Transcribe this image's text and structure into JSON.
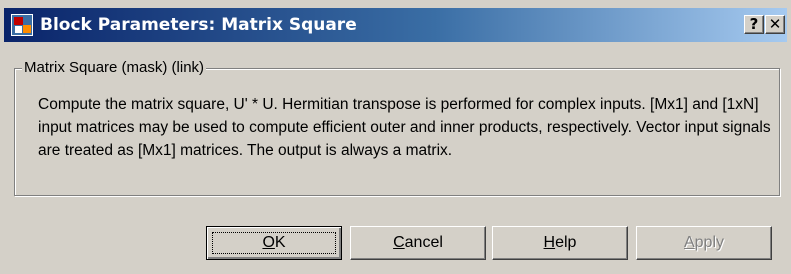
{
  "window": {
    "title": "Block Parameters: Matrix Square",
    "help_glyph": "?",
    "close_glyph": "✕"
  },
  "group": {
    "legend": "Matrix Square (mask) (link)",
    "description": "Compute the matrix square, U' * U.  Hermitian transpose is performed for complex inputs.  [Mx1] and [1xN] input matrices may be used to compute efficient outer and inner products, respectively. Vector input signals are treated as [Mx1] matrices. The output is always a matrix."
  },
  "buttons": {
    "ok": "OK",
    "cancel": "Cancel",
    "help": "Help",
    "apply": "Apply"
  }
}
